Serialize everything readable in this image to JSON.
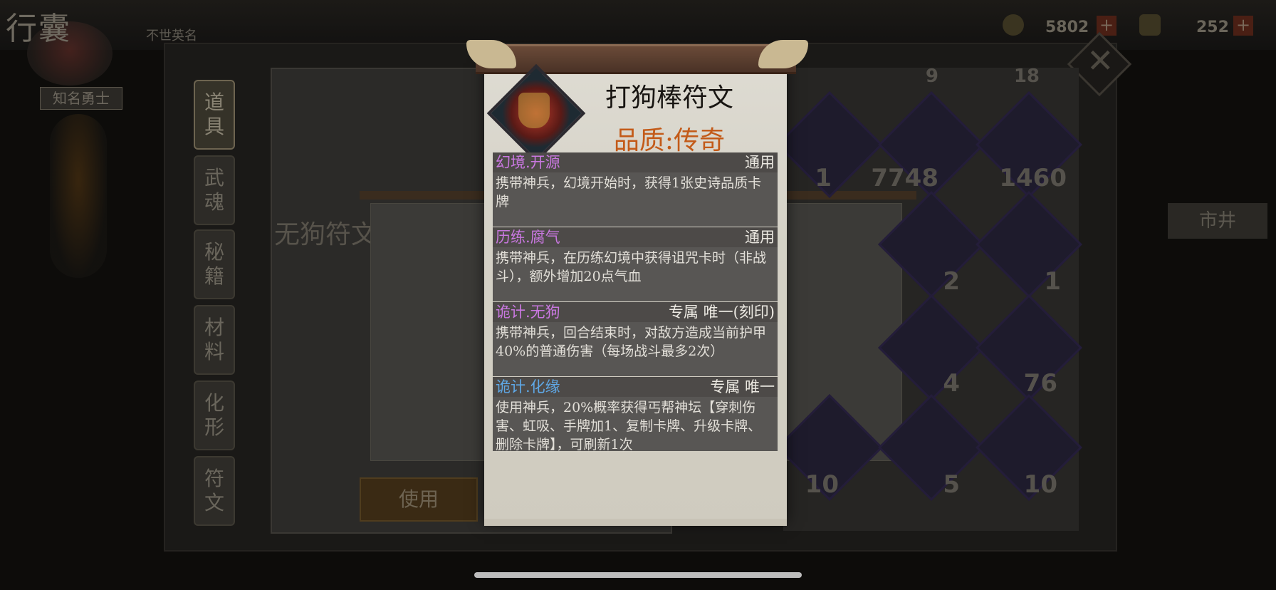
{
  "header": {
    "title": "行囊",
    "subtitle": "不世英名",
    "badge": "知名勇士",
    "currency1": "5802",
    "currency2": "252",
    "plus_label": "+"
  },
  "tabs": [
    {
      "label": "道\n具"
    },
    {
      "label": "武\n魂"
    },
    {
      "label": "秘\n籍"
    },
    {
      "label": "材\n料"
    },
    {
      "label": "化\n形"
    },
    {
      "label": "符\n文"
    }
  ],
  "left_panel": {
    "empty_text": "无狗符文",
    "use_button": "使用"
  },
  "grid_counts": [
    "1",
    "7748",
    "1460",
    "2",
    "1",
    "4",
    "76",
    "10",
    "5",
    "10"
  ],
  "top_counts": [
    "9",
    "18"
  ],
  "market_label": "市井",
  "tooltip": {
    "title": "打狗棒符文",
    "quality": "品质:传奇",
    "sections": [
      {
        "name": "幻境.开源",
        "name_color": "#c978e0",
        "tag": "通用",
        "body": "携带神兵，幻境开始时，获得1张史诗品质卡牌"
      },
      {
        "name": "历练.腐气",
        "name_color": "#c978e0",
        "tag": "通用",
        "body": "携带神兵，在历练幻境中获得诅咒卡时（非战斗），额外增加20点气血"
      },
      {
        "name": "诡计.无狗",
        "name_color": "#c978e0",
        "tag": "专属 唯一(刻印)",
        "body": "携带神兵，回合结束时，对敌方造成当前护甲40%的普通伤害（每场战斗最多2次）"
      },
      {
        "name": "诡计.化缘",
        "name_color": "#5fa8e6",
        "tag": "专属 唯一",
        "body": "使用神兵，20%概率获得丐帮神坛【穿刺伤害、虹吸、手牌加1、复制卡牌、升级卡牌、删除卡牌】，可刷新1次"
      }
    ]
  }
}
